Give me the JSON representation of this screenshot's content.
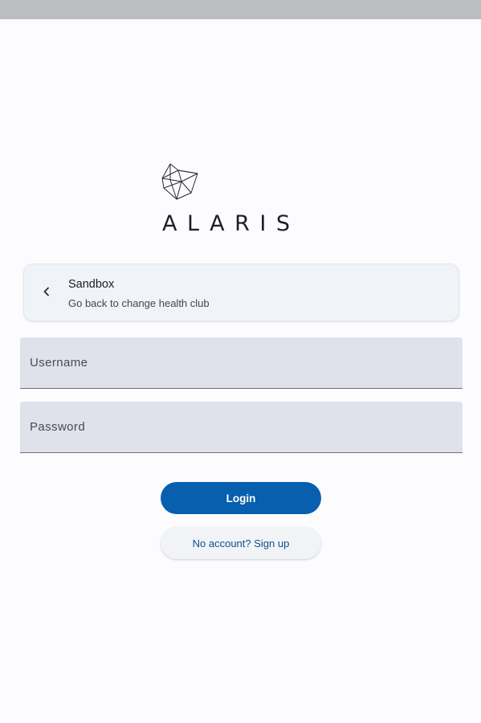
{
  "app": {
    "brand": "ALARIS",
    "logo_icon": "alaris-geometric-logo-icon"
  },
  "club": {
    "name": "Sandbox",
    "subtitle": "Go back to change health club",
    "icon": "chevron-left-icon"
  },
  "form": {
    "username_placeholder": "Username",
    "password_placeholder": "Password"
  },
  "actions": {
    "login_label": "Login",
    "signup_label": "No account? Sign up"
  },
  "colors": {
    "primary": "#075fad",
    "link": "#0d4f8f",
    "field_background": "#dfe2ea",
    "card_background": "#f0f3f7",
    "page_background": "#fcfcfe",
    "status_bar": "#bcbdc0"
  }
}
